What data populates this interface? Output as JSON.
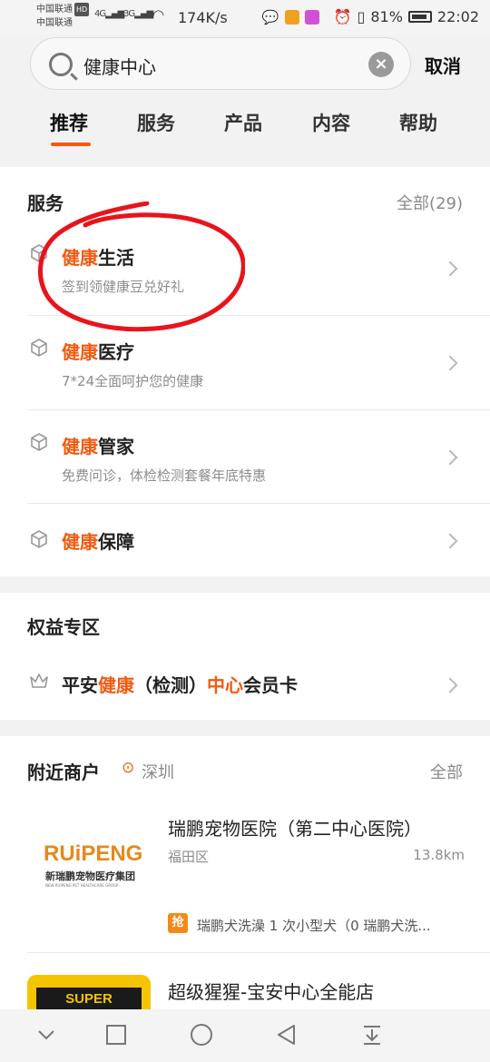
{
  "status_bar": {
    "carrier1": "中国联通",
    "carrier2": "中国联通",
    "hd": "HD",
    "signal1": "4G",
    "signal2": "3G",
    "speed": "174K/s",
    "battery": "81%",
    "time": "22:02"
  },
  "search": {
    "value": "健康中心",
    "cancel_label": "取消"
  },
  "tabs": [
    {
      "label": "推荐",
      "active": true
    },
    {
      "label": "服务",
      "active": false
    },
    {
      "label": "产品",
      "active": false
    },
    {
      "label": "内容",
      "active": false
    },
    {
      "label": "帮助",
      "active": false
    }
  ],
  "services": {
    "title": "服务",
    "all_label": "全部(29)",
    "items": [
      {
        "highlight": "健康",
        "title_rest": "生活",
        "subtitle": "签到领健康豆兑好礼"
      },
      {
        "highlight": "健康",
        "title_rest": "医疗",
        "subtitle": "7*24全面呵护您的健康"
      },
      {
        "highlight": "健康",
        "title_rest": "管家",
        "subtitle": "免费问诊，体检检测套餐年底特惠"
      },
      {
        "highlight": "健康",
        "title_rest": "保障",
        "subtitle": ""
      }
    ]
  },
  "benefits": {
    "title": "权益专区",
    "item": {
      "part1": "平安",
      "hl1": "健康",
      "part2": "（检测）",
      "hl2": "中心",
      "part3": "会员卡"
    }
  },
  "nearby": {
    "title": "附近商户",
    "city": "深圳",
    "all_label": "全部",
    "merchants": [
      {
        "name": "瑞鹏宠物医院（第二中心医院）",
        "area": "福田区",
        "distance": "13.8km",
        "deal_badge": "抢",
        "deal": "瑞鹏犬洗澡 1 次小型犬（0 瑞鹏犬洗...",
        "logo_text": "RUiPENG",
        "logo_sub": "新瑞鹏宠物医疗集团",
        "logo_tiny": "NEW RUIPENG PET HEALTHCARE GROUP"
      },
      {
        "name": "超级猩猩-宝安中心全能店",
        "logo_text": "SUPER MONKEY"
      }
    ]
  },
  "colors": {
    "accent": "#f25a10",
    "annotation": "#e8141c"
  }
}
